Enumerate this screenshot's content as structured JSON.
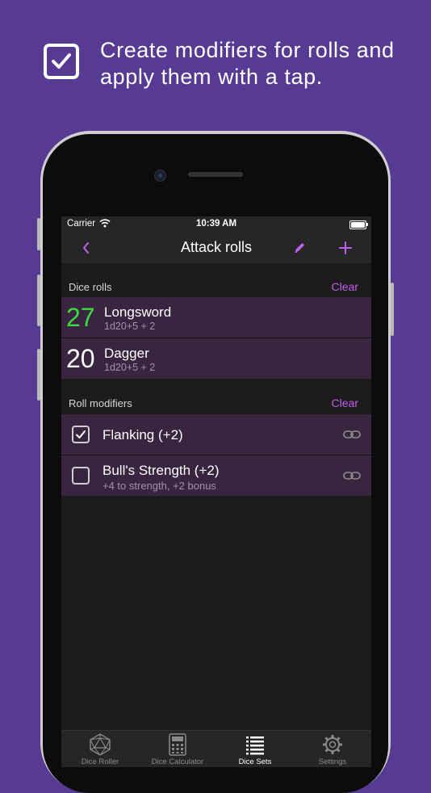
{
  "headline": {
    "text": "Create modifiers for rolls and apply them with a tap.",
    "icon": "checkbox-icon"
  },
  "status_bar": {
    "carrier": "Carrier",
    "time": "10:39 AM"
  },
  "nav": {
    "title": "Attack rolls",
    "back_icon": "chevron-left-icon",
    "edit_icon": "pencil-icon",
    "add_icon": "plus-icon"
  },
  "dice_rolls": {
    "header": "Dice rolls",
    "clear_label": "Clear",
    "items": [
      {
        "total": "27",
        "name": "Longsword",
        "formula": "1d20+5 + 2",
        "total_color": "#3ed93e"
      },
      {
        "total": "20",
        "name": "Dagger",
        "formula": "1d20+5 + 2",
        "total_color": "#ffffff"
      }
    ]
  },
  "roll_modifiers": {
    "header": "Roll modifiers",
    "clear_label": "Clear",
    "items": [
      {
        "name": "Flanking (+2)",
        "description": "",
        "checked": true
      },
      {
        "name": "Bull's Strength (+2)",
        "description": "+4 to strength, +2 bonus",
        "checked": false
      }
    ]
  },
  "tabs": [
    {
      "label": "Dice Roller",
      "icon": "d20-icon",
      "active": false
    },
    {
      "label": "Dice Calculator",
      "icon": "calculator-icon",
      "active": false
    },
    {
      "label": "Dice Sets",
      "icon": "list-icon",
      "active": true
    },
    {
      "label": "Settings",
      "icon": "gear-icon",
      "active": false
    }
  ],
  "colors": {
    "background": "#563a93",
    "accent": "#c25ef0",
    "row_background": "#3a2540",
    "highlight_total": "#3ed93e"
  }
}
